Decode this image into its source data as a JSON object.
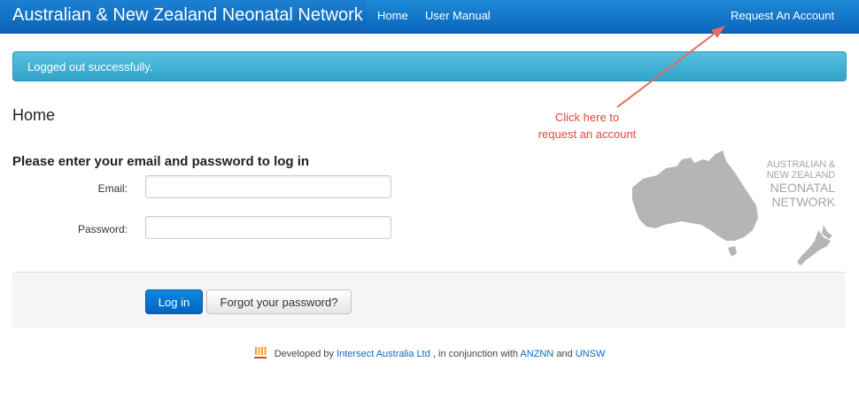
{
  "navbar": {
    "brand": "Australian & New Zealand Neonatal Network",
    "home": "Home",
    "user_manual": "User Manual",
    "request_account": "Request An Account"
  },
  "alert": {
    "message": "Logged out successfully."
  },
  "page": {
    "title": "Home"
  },
  "annotation": {
    "line1": "Click here to",
    "line2": "request an account"
  },
  "form": {
    "heading": "Please enter your email and password to log in",
    "email_label": "Email:",
    "email_value": "",
    "password_label": "Password:",
    "password_value": "",
    "login_button": "Log in",
    "forgot_button": "Forgot your password?"
  },
  "logo": {
    "line1": "AUSTRALIAN &",
    "line2": "NEW ZEALAND",
    "line3": "NEONATAL",
    "line4": "NETWORK",
    "icon": "australia-nz-map-icon"
  },
  "footer": {
    "prefix": "Developed by",
    "intersect": "Intersect Australia Ltd",
    "middle": ", in conjunction with",
    "anznn": "ANZNN",
    "and": "and",
    "unsw": "UNSW",
    "icon": "intersect-logo-icon"
  },
  "colors": {
    "nav_blue": "#0a66bd",
    "alert_blue": "#5bc0de",
    "annotation_red": "#e2453c",
    "link_blue": "#0a6bc4",
    "logo_gray": "#a5a5a5"
  }
}
